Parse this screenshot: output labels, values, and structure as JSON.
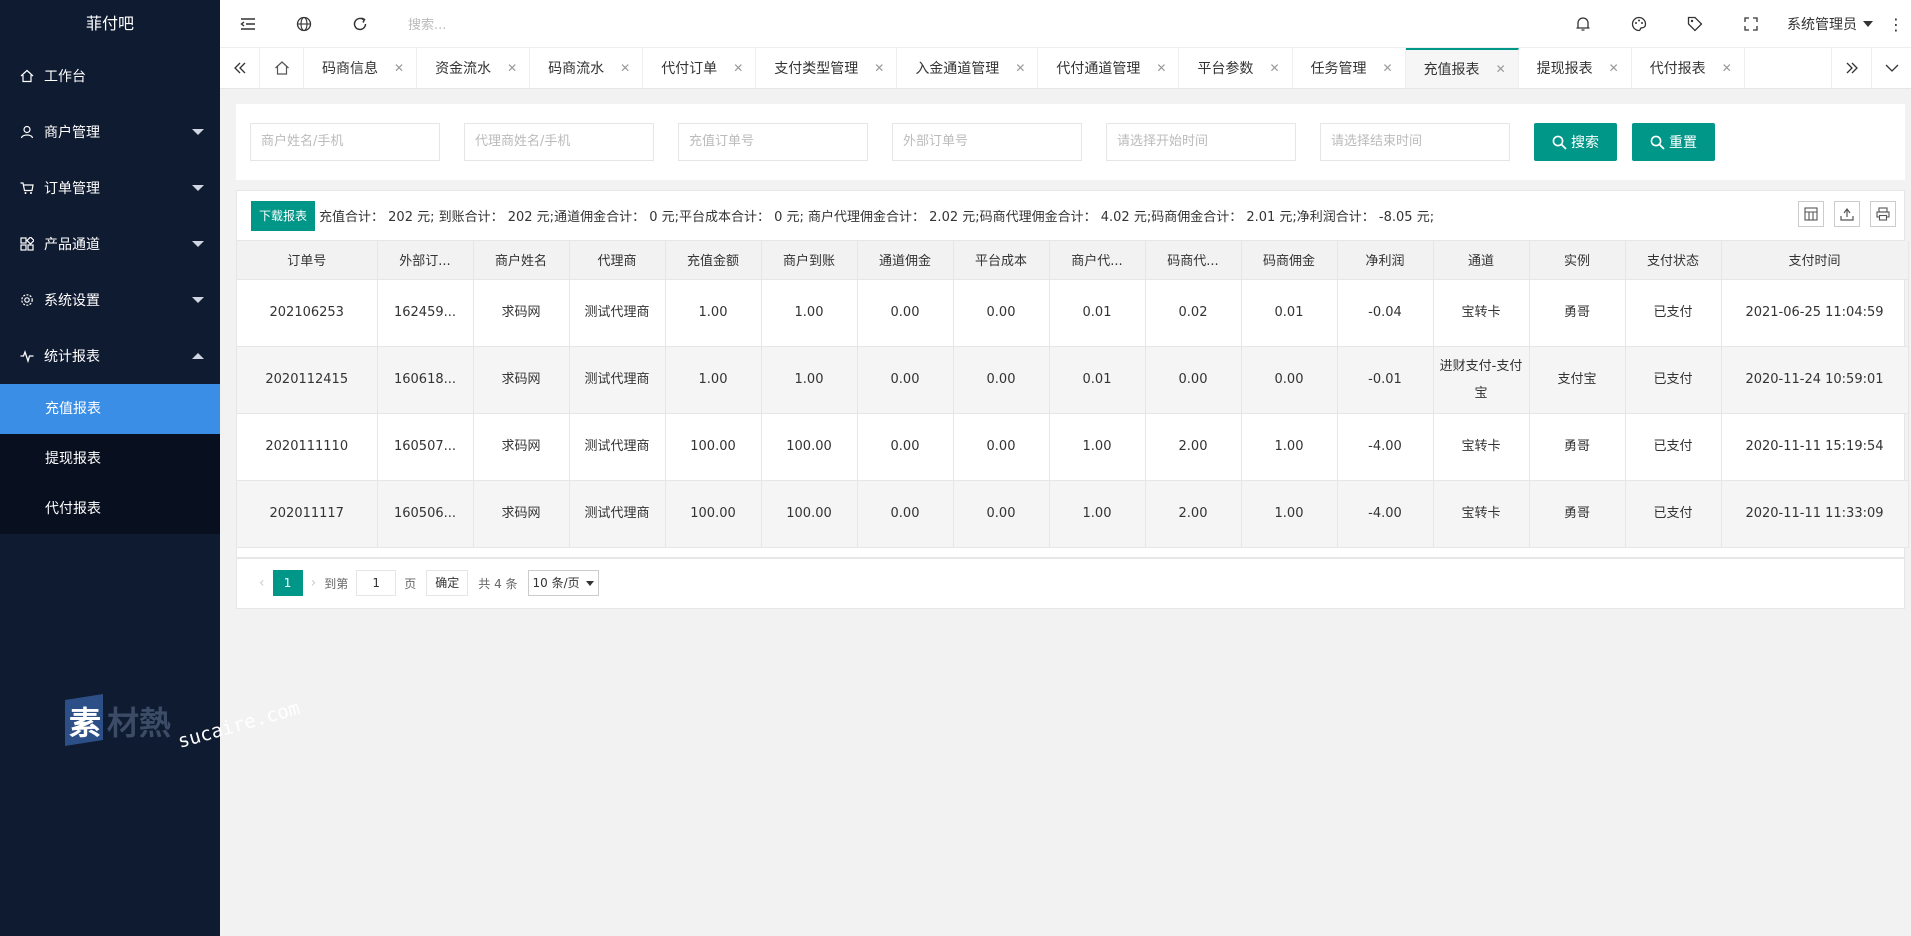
{
  "app": {
    "logo": "菲付吧"
  },
  "sidebar": {
    "items": [
      {
        "label": "工作台",
        "icon": "home-icon"
      },
      {
        "label": "商户管理",
        "icon": "user-icon"
      },
      {
        "label": "订单管理",
        "icon": "cart-icon"
      },
      {
        "label": "产品通道",
        "icon": "grid-icon"
      },
      {
        "label": "系统设置",
        "icon": "gear-icon"
      },
      {
        "label": "统计报表",
        "icon": "pulse-icon"
      }
    ],
    "subitems": [
      "充值报表",
      "提现报表",
      "代付报表"
    ]
  },
  "topbar": {
    "search_placeholder": "搜索...",
    "user": "系统管理员"
  },
  "tabs": [
    "码商信息",
    "资金流水",
    "码商流水",
    "代付订单",
    "支付类型管理",
    "入金通道管理",
    "代付通道管理",
    "平台参数",
    "任务管理",
    "充值报表",
    "提现报表",
    "代付报表"
  ],
  "filters": {
    "merchant": "商户姓名/手机",
    "agent": "代理商姓名/手机",
    "order_no": "充值订单号",
    "external_no": "外部订单号",
    "start_time": "请选择开始时间",
    "end_time": "请选择结束时间",
    "search_btn": "搜索",
    "reset_btn": "重置"
  },
  "toolbar": {
    "download": "下载报表",
    "summary": "充值合计：  202 元; 到账合计：  202 元;通道佣金合计：  0 元;平台成本合计：  0 元; 商户代理佣金合计：  2.02 元;码商代理佣金合计：  4.02 元;码商佣金合计：  2.01 元;净利润合计：  -8.05 元;"
  },
  "table": {
    "headers": [
      "订单号",
      "外部订...",
      "商户姓名",
      "代理商",
      "充值金额",
      "商户到账",
      "通道佣金",
      "平台成本",
      "商户代...",
      "码商代...",
      "码商佣金",
      "净利润",
      "通道",
      "实例",
      "支付状态",
      "支付时间"
    ],
    "rows": [
      [
        "202106253",
        "162459...",
        "求码网",
        "测试代理商",
        "1.00",
        "1.00",
        "0.00",
        "0.00",
        "0.01",
        "0.02",
        "0.01",
        "-0.04",
        "宝转卡",
        "勇哥",
        "已支付",
        "2021-06-25 11:04:59"
      ],
      [
        "2020112415",
        "160618...",
        "求码网",
        "测试代理商",
        "1.00",
        "1.00",
        "0.00",
        "0.00",
        "0.01",
        "0.00",
        "0.00",
        "-0.01",
        "进财支付-支付宝",
        "支付宝",
        "已支付",
        "2020-11-24 10:59:01"
      ],
      [
        "2020111110",
        "160507...",
        "求码网",
        "测试代理商",
        "100.00",
        "100.00",
        "0.00",
        "0.00",
        "1.00",
        "2.00",
        "1.00",
        "-4.00",
        "宝转卡",
        "勇哥",
        "已支付",
        "2020-11-11 15:19:54"
      ],
      [
        "202011117",
        "160506...",
        "求码网",
        "测试代理商",
        "100.00",
        "100.00",
        "0.00",
        "0.00",
        "1.00",
        "2.00",
        "1.00",
        "-4.00",
        "宝转卡",
        "勇哥",
        "已支付",
        "2020-11-11 11:33:09"
      ]
    ]
  },
  "pager": {
    "current": "1",
    "goto_label": "到第",
    "page_value": "1",
    "page_label": "页",
    "confirm": "确定",
    "total": "共 4 条",
    "per_page": "10 条/页"
  },
  "watermark": {
    "brand": "素材熱",
    "site": "sucaire.com"
  },
  "colors": {
    "sidebar_bg": "#0f1b30",
    "accent": "#009688",
    "active_menu": "#3a8ee6"
  }
}
